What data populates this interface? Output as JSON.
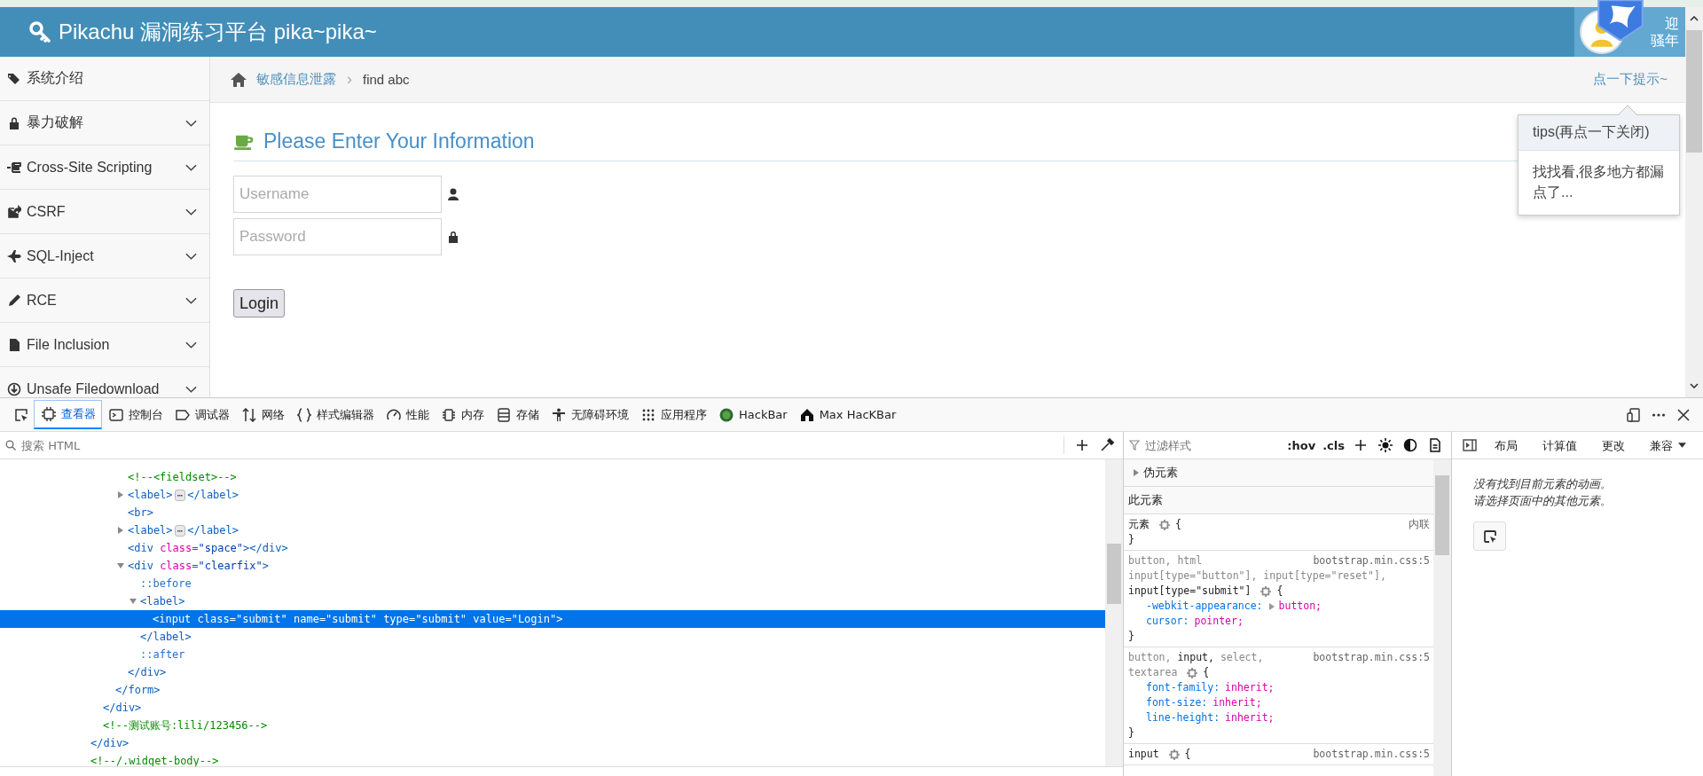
{
  "header": {
    "title": "Pikachu 漏洞练习平台 pika~pika~",
    "greeting": [
      "迎",
      "骚年"
    ]
  },
  "sidebar": {
    "items": [
      {
        "label": "系统介绍",
        "kind": "link"
      },
      {
        "label": "暴力破解",
        "kind": "menu"
      },
      {
        "label": "Cross-Site Scripting",
        "kind": "menu"
      },
      {
        "label": "CSRF",
        "kind": "menu"
      },
      {
        "label": "SQL-Inject",
        "kind": "menu"
      },
      {
        "label": "RCE",
        "kind": "menu"
      },
      {
        "label": "File Inclusion",
        "kind": "menu"
      },
      {
        "label": "Unsafe Filedownload",
        "kind": "menu"
      }
    ]
  },
  "breadcrumb": {
    "section": "敏感信息泄露",
    "separator": "›",
    "current": "find abc",
    "hint_link": "点一下提示~"
  },
  "form": {
    "heading": "Please Enter Your Information",
    "fields": [
      {
        "placeholder": "Username",
        "kind": "user"
      },
      {
        "placeholder": "Password",
        "kind": "password"
      }
    ],
    "submit": "Login"
  },
  "tips_popover": {
    "title": "tips(再点一下关闭)",
    "body": "找找看,很多地方都漏点了..."
  },
  "devtools": {
    "tabs": [
      {
        "label": "查看器",
        "selected": true
      },
      {
        "label": "控制台",
        "selected": false
      },
      {
        "label": "调试器",
        "selected": false
      },
      {
        "label": "网络",
        "selected": false
      },
      {
        "label": "样式编辑器",
        "selected": false
      },
      {
        "label": "性能",
        "selected": false
      },
      {
        "label": "内存",
        "selected": false
      },
      {
        "label": "存储",
        "selected": false
      },
      {
        "label": "无障碍环境",
        "selected": false
      },
      {
        "label": "应用程序",
        "selected": false
      },
      {
        "label": "HackBar",
        "selected": false
      },
      {
        "label": "Max HacKBar",
        "selected": false
      }
    ],
    "markup_search": {
      "placeholder": "搜索 HTML"
    },
    "html_tree": [
      {
        "close": "</div>",
        "children": [
          {
            "close": "</div>",
            "children": [
              {
                "close": "</form>",
                "children": [
                  {
                    "kind": "comment",
                    "open": "<!--<fieldset>-->",
                    "selected": false
                  },
                  {
                    "kind": "element",
                    "open": "<label>",
                    "expanded": false,
                    "badge": "⋯",
                    "inline_close": "</label>",
                    "selected": false
                  },
                  {
                    "kind": "element",
                    "open": "<br>",
                    "selected": false
                  },
                  {
                    "kind": "element",
                    "open": "<label>",
                    "expanded": false,
                    "badge": "⋯",
                    "inline_close": "</label>",
                    "selected": false
                  },
                  {
                    "kind": "element",
                    "open": "<div class=\"space\">",
                    "inline_close": "</div>",
                    "selected": false
                  },
                  {
                    "kind": "element",
                    "open": "<div class=\"clearfix\">",
                    "expanded": true,
                    "selected": false,
                    "close": "</div>",
                    "children": [
                      {
                        "kind": "pseudo",
                        "open": "::before",
                        "selected": false
                      },
                      {
                        "kind": "element",
                        "open": "<label>",
                        "expanded": true,
                        "selected": false,
                        "close": "</label>",
                        "children": [
                          {
                            "kind": "element",
                            "open": "<input class=\"submit\" name=\"submit\" type=\"submit\" value=\"Login\">",
                            "selected": true
                          }
                        ]
                      },
                      {
                        "kind": "pseudo",
                        "open": "::after",
                        "selected": false
                      }
                    ]
                  }
                ]
              }
            ]
          },
          {
            "kind": "comment",
            "open": "<!--测试账号:lili/123456-->",
            "selected": false
          }
        ]
      },
      {
        "kind": "comment",
        "open": "<!--/.widget-body-->",
        "selected": false
      }
    ],
    "rules_panel": {
      "filter": {
        "placeholder": "过滤样式"
      },
      "toggles": [
        ":hov",
        ".cls"
      ],
      "pseudo_elements": {
        "label": "伪元素",
        "expanded": false
      },
      "section_title": "此元素",
      "rules": [
        {
          "selectors": [
            {
              "text": "元素",
              "matched": true
            }
          ],
          "open_brace": "{",
          "close_brace": "}",
          "source": "内联"
        },
        {
          "selectors": [
            {
              "text": "button, html",
              "matched": false
            },
            {
              "text": "input[type=\"button\"],",
              "matched": false
            },
            {
              "text": "input[type=\"reset\"],",
              "matched": false
            },
            {
              "text": "input[type=\"submit\"]",
              "matched": true
            }
          ],
          "open_brace": "{",
          "close_brace": "}",
          "source": "bootstrap.min.css:5",
          "declarations": [
            {
              "property": "-webkit-appearance:",
              "value": "button;",
              "expandable": true
            },
            {
              "property": "cursor:",
              "value": "pointer;",
              "expandable": false
            }
          ]
        },
        {
          "selectors": [
            {
              "text": "button,",
              "matched": false
            },
            {
              "text": "input,",
              "matched": true
            },
            {
              "text": "select,",
              "matched": false
            },
            {
              "text": "textarea",
              "matched": false
            }
          ],
          "open_brace": "{",
          "close_brace": "}",
          "source": "bootstrap.min.css:5",
          "declarations": [
            {
              "property": "font-family:",
              "value": "inherit;",
              "expandable": false
            },
            {
              "property": "font-size:",
              "value": "inherit;",
              "expandable": false
            },
            {
              "property": "line-height:",
              "value": "inherit;",
              "expandable": false
            }
          ]
        },
        {
          "selectors": [
            {
              "text": "input",
              "matched": true
            }
          ],
          "open_brace": "{",
          "source": "bootstrap.min.css:5"
        }
      ]
    },
    "side_panel": {
      "tabs": [
        {
          "label": "布局",
          "selected": false
        },
        {
          "label": "计算值",
          "selected": false
        },
        {
          "label": "更改",
          "selected": false
        },
        {
          "label": "兼容",
          "selected": false
        }
      ],
      "messages": [
        "没有找到目前元素的动画。",
        "请选择页面中的其他元素。"
      ]
    }
  }
}
